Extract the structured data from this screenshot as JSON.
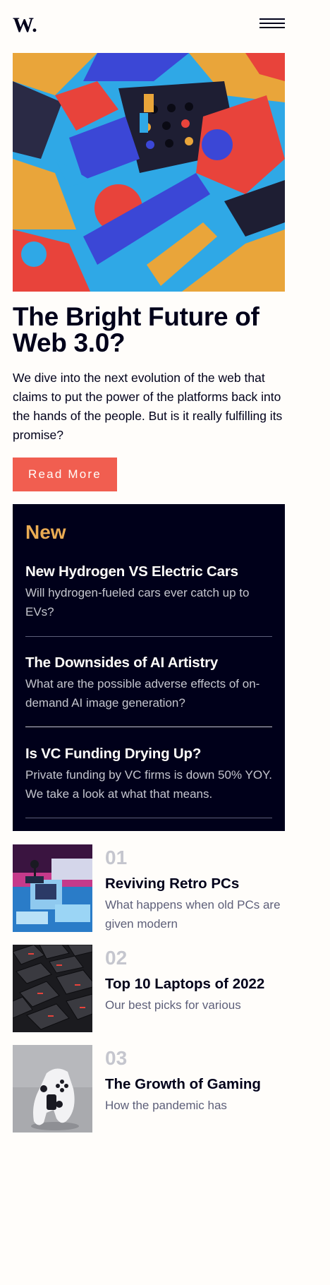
{
  "header": {
    "logo_icon": "w-logo-icon",
    "menu_icon": "hamburger-menu-icon"
  },
  "hero": {
    "title_line1": "The Bright Future of",
    "title_line2": "Web 3.0?",
    "description": "We dive into the next evolution of the web that claims to put the power of the platforms back into the hands of the people. But is it really fulfilling its promise?",
    "cta_label": "Read More"
  },
  "new_section": {
    "heading": "New",
    "items": [
      {
        "title": "New Hydrogen VS Electric Cars",
        "description": "Will hydrogen-fueled cars ever catch up to EVs?"
      },
      {
        "title": "The Downsides of AI Artistry",
        "description": "What are the possible adverse effects of on-demand AI image generation?"
      },
      {
        "title": "Is VC Funding Drying Up?",
        "description": "Private funding by VC firms is down 50% YOY. We take a look at what that means."
      }
    ]
  },
  "trending": [
    {
      "number": "01",
      "title": "Reviving Retro PCs",
      "description": "What happens when old PCs are given modern"
    },
    {
      "number": "02",
      "title": "Top 10 Laptops of 2022",
      "description": "Our best picks for various"
    },
    {
      "number": "03",
      "title": "The Growth of Gaming",
      "description": "How the pandemic has"
    }
  ],
  "colors": {
    "off_white": "#fffdfa",
    "very_dark_blue": "#00001a",
    "soft_orange": "#e9ab53",
    "soft_red": "#f15e50",
    "grayish_blue": "#c5c6ce",
    "dark_grayish_blue": "#5d5f79"
  }
}
